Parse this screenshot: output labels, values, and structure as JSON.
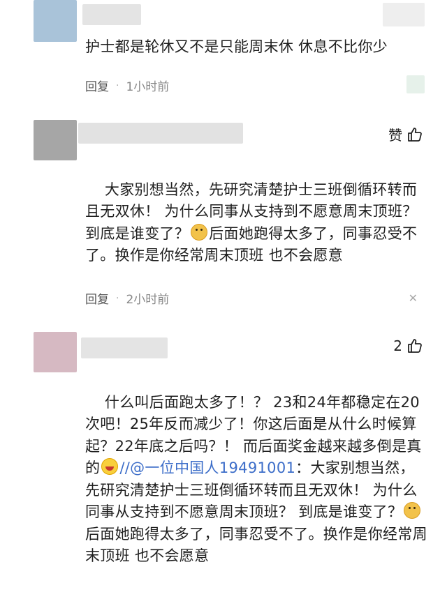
{
  "comments": [
    {
      "text": "护士都是轮休又不是只能周末休 休息不比你少",
      "reply_label": "回复",
      "separator": "·",
      "time": "1小时前"
    },
    {
      "text_a": "大家别想当然，先研究清楚护士三班倒循环转而且无双休！ 为什么同事从支持到不愿意周末顶班？ 到底是谁变了？",
      "text_b": "后面她跑得太多了，同事忍受不了。换作是你经常周末顶班 也不会愿意",
      "emoji_icon": "dog-face-icon",
      "like_label": "赞",
      "like_icon": "thumbs-up-icon",
      "reply_label": "回复",
      "separator": "·",
      "time": "2小时前"
    },
    {
      "text_a": "什么叫后面跑太多了！？ 23和24年都稳定在20次吧！25年反而减少了！你这后面是从什么时候算起？22年底之后吗？！ 而后面奖金越来越多倒是真的",
      "emoji_laugh_icon": "laughing-face-icon",
      "mention": "//@一位中国人19491001",
      "text_b": "：大家别想当然，先研究清楚护士三班倒循环转而且无双休！ 为什么同事从支持到不愿意周末顶班？ 到底是谁变了？",
      "emoji_icon": "dog-face-icon",
      "text_c": "后面她跑得太多了，同事忍受不了。换作是你经常周末顶班 也不会愿意",
      "like_count": "2",
      "like_icon": "thumbs-up-icon"
    }
  ],
  "colors": {
    "avatar1": "#a9c3d9",
    "avatar2": "#a6a6a6",
    "avatar3": "#d6b9c2",
    "mention": "#3d6ec9"
  }
}
